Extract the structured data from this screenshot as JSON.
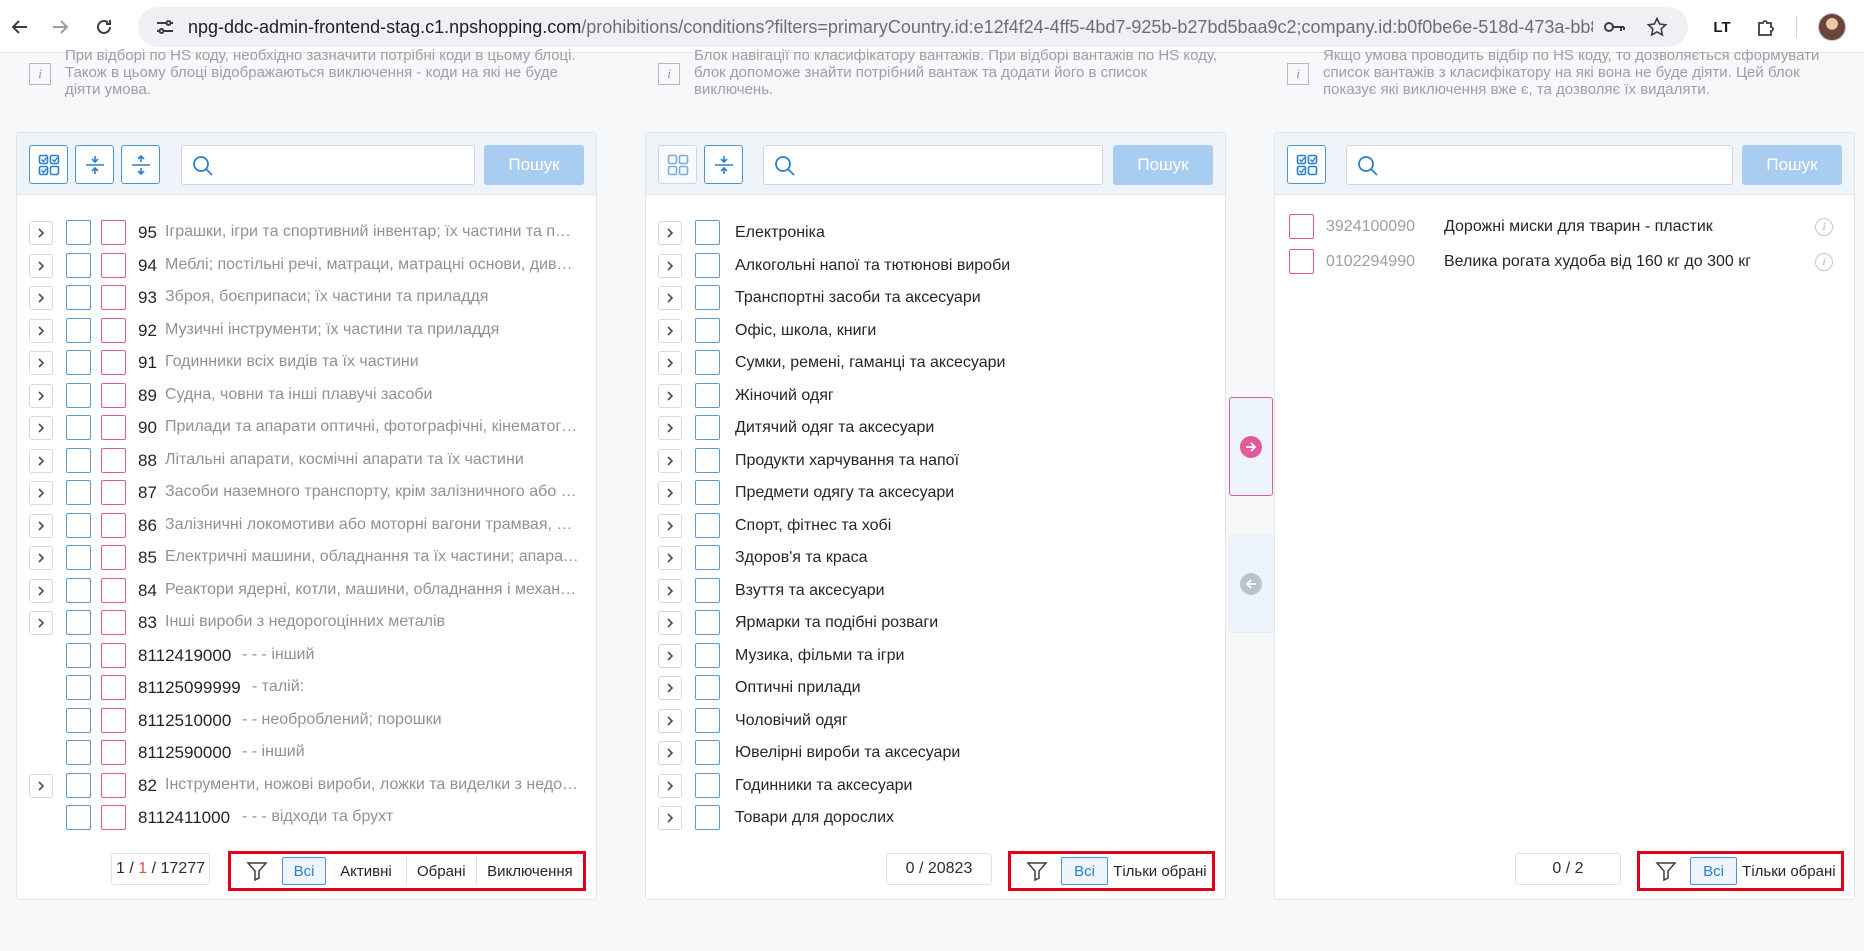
{
  "browser": {
    "url_host": "npg-ddc-admin-frontend-stag.c1.npshopping.com",
    "url_path": "/prohibitions/conditions?filters=primaryCountry.id:e12f4f24-4ff5-4bd7-925b-b27bd5baa9c2;company.id:b0f0be6e-518d-473a-bb8...",
    "extension_label": "LT"
  },
  "hints": {
    "left": "При відборі по HS коду, необхідно зазначити потрібні коди в цьому блоці. Також в цьому блоці відображаються виключення - коди на які не буде діяти умова.",
    "middle": "Блок навігації по класифікатору вантажів. При відборі вантажів по HS коду, блок допоможе знайти потрібний вантаж та додати його в список виключень.",
    "right": "Якщо умова проводить відбір по HS коду, то дозволяється сформувати список вантажів з класифікатору на які вона не буде діяти. Цей блок показує які виключення вже є, та дозволяє їх видаляти."
  },
  "search_button_label": "Пошук",
  "left_panel": {
    "rows": [
      {
        "code": "95",
        "desc": "Іграшки, ігри та спортивний інвентар; їх частини та приладдя",
        "expandable": true
      },
      {
        "code": "94",
        "desc": "Меблі; постільні речі, матраци, матрацні основи, диванні подушки",
        "expandable": true
      },
      {
        "code": "93",
        "desc": "Зброя, боєприпаси; їх частини та приладдя",
        "expandable": true
      },
      {
        "code": "92",
        "desc": "Музичні інструменти; їх частини та приладдя",
        "expandable": true
      },
      {
        "code": "91",
        "desc": "Годинники всіх видів та їх частини",
        "expandable": true
      },
      {
        "code": "89",
        "desc": "Судна, човни та інші плавучі засоби",
        "expandable": true
      },
      {
        "code": "90",
        "desc": "Прилади та апарати оптичні, фотографічні, кінематографічні",
        "expandable": true
      },
      {
        "code": "88",
        "desc": "Літальні апарати, космічні апарати та їх частини",
        "expandable": true
      },
      {
        "code": "87",
        "desc": "Засоби наземного транспорту, крім залізничного або трамвайного",
        "expandable": true
      },
      {
        "code": "86",
        "desc": "Залізничні локомотиви або моторні вагони трамвая, рухомий склад",
        "expandable": true
      },
      {
        "code": "85",
        "desc": "Електричні машини, обладнання та їх частини; апаратура",
        "expandable": true
      },
      {
        "code": "84",
        "desc": "Реактори ядерні, котли, машини, обладнання і механічні пристрої",
        "expandable": true
      },
      {
        "code": "83",
        "desc": "Інші вироби з недорогоцінних металів",
        "expandable": true
      },
      {
        "code": "8112419000",
        "desc": "- - - інший",
        "expandable": false
      },
      {
        "code": "81125099999",
        "desc": "- талій:",
        "expandable": false
      },
      {
        "code": "8112510000",
        "desc": "- - необроблений; порошки",
        "expandable": false
      },
      {
        "code": "8112590000",
        "desc": "- - інший",
        "expandable": false
      },
      {
        "code": "82",
        "desc": "Інструменти, ножові вироби, ложки та виделки з недорогоцінних металів",
        "expandable": true
      },
      {
        "code": "8112411000",
        "desc": "- - - відходи та брухт",
        "expandable": false
      }
    ],
    "counter": {
      "page": "1",
      "sep": "/",
      "page_red": "1",
      "total": "17277"
    },
    "filters": [
      "Всі",
      "Активні",
      "Обрані",
      "Виключення"
    ]
  },
  "middle_panel": {
    "rows": [
      "Електроніка",
      "Алкогольні напої та тютюнові вироби",
      "Транспортні засоби та аксесуари",
      "Офіс, школа, книги",
      "Сумки, ремені, гаманці та аксесуари",
      "Жіночий одяг",
      "Дитячий одяг та аксесуари",
      "Продукти харчування та напої",
      "Предмети одягу та аксесуари",
      "Спорт, фітнес та хобі",
      "Здоров'я та краса",
      "Взуття та аксесуари",
      "Ярмарки та подібні розваги",
      "Музика, фільми та ігри",
      "Оптичні прилади",
      "Чоловічий одяг",
      "Ювелірні вироби та аксесуари",
      "Годинники та аксесуари",
      "Товари для дорослих"
    ],
    "counter": "0 / 20823",
    "filters": [
      "Всі",
      "Тільки обрані"
    ]
  },
  "right_panel": {
    "rows": [
      {
        "code": "3924100090",
        "name": "Дорожні миски для тварин - пластик"
      },
      {
        "code": "0102294990",
        "name": "Велика рогата худоба від 160 кг до 300 кг"
      }
    ],
    "counter": "0 / 2",
    "filters": [
      "Всі",
      "Тільки обрані"
    ]
  },
  "colors": {
    "accent_blue": "#4b95d6",
    "accent_pink": "#e25a9e",
    "highlight_red": "#e0001a"
  }
}
